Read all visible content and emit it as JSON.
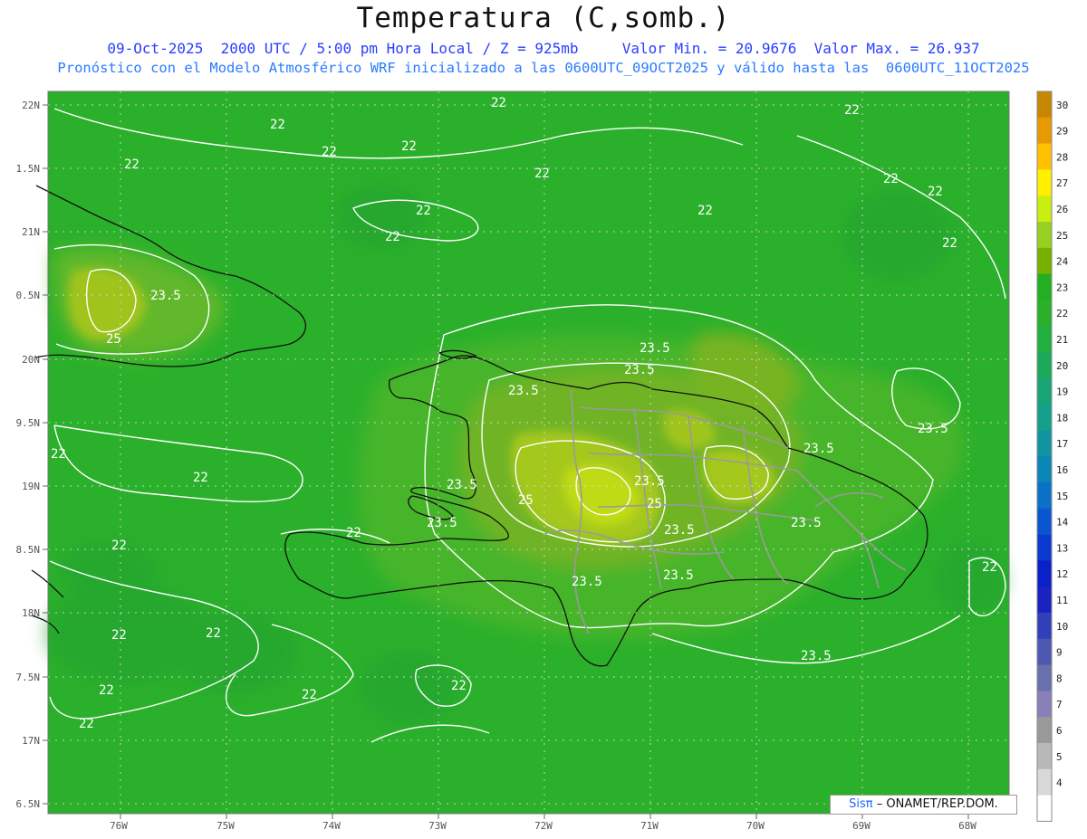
{
  "header": {
    "title": "Temperatura (C,somb.)",
    "info_line": "09-Oct-2025  2000 UTC / 5:00 pm Hora Local / Z = 925mb     Valor Min. = 20.9676  Valor Max. = 26.937",
    "model_line": "Pronóstico con el Modelo Atmosférico WRF inicializado a las 0600UTC_09OCT2025 y válido hasta las  0600UTC_11OCT2025"
  },
  "map": {
    "lat_labels": [
      "22N",
      "1.5N",
      "21N",
      "0.5N",
      "20N",
      "9.5N",
      "19N",
      "8.5N",
      "18N",
      "7.5N",
      "17N",
      "6.5N"
    ],
    "lon_labels": [
      "76W",
      "75W",
      "74W",
      "73W",
      "72W",
      "71W",
      "70W",
      "69W",
      "68W"
    ],
    "contour_labels": [
      "22",
      "23.5",
      "25"
    ],
    "colors": {
      "ocean": "#2bb02b",
      "warm_23": "#4cb82a",
      "warm_24": "#78b424",
      "warm_25": "#9bc21e",
      "warm_26": "#b8d81a",
      "contour": "#ffffff",
      "coast": "#111111",
      "borders": "#9a9a9a"
    }
  },
  "colorbar": {
    "levels": [
      "30",
      "29",
      "28",
      "27",
      "26",
      "25",
      "24",
      "23",
      "22",
      "21",
      "20",
      "19",
      "18",
      "17",
      "16",
      "15",
      "14",
      "13",
      "12",
      "11",
      "10",
      "9",
      "8",
      "7",
      "6",
      "5",
      "4"
    ],
    "colors": [
      "#c88700",
      "#e79a00",
      "#ffc000",
      "#fff000",
      "#c8ef10",
      "#96d020",
      "#78b000",
      "#22b022",
      "#2ab02a",
      "#1fb040",
      "#1aaa5a",
      "#18a474",
      "#14a08a",
      "#1095a0",
      "#0a86b6",
      "#0a70c8",
      "#0a55d0",
      "#0a3ad0",
      "#0a20c8",
      "#1a22c0",
      "#3040b8",
      "#4d58b0",
      "#6a70ac",
      "#8a80b8",
      "#9a9a9a",
      "#b8b8b8",
      "#d8d8d8",
      "#ffffff"
    ]
  },
  "credit": {
    "brand": "Sisπ",
    "text": "– ONAMET/REP.DOM."
  }
}
